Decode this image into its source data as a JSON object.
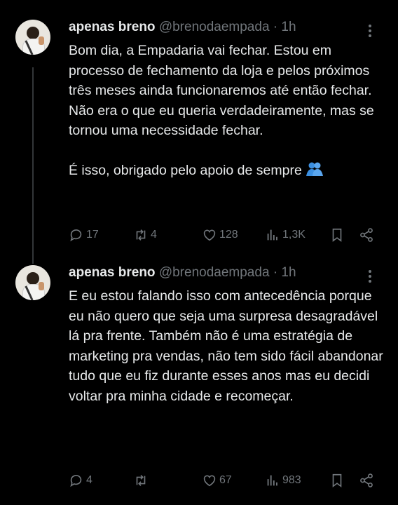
{
  "tweets": [
    {
      "name": "apenas breno",
      "handle": "@brenodaempada",
      "time": "1h",
      "text": "Bom dia, a Empadaria vai fechar. Estou em processo de fechamento da loja e pelos próximos três meses ainda funcionaremos até então fechar. Não era o que eu queria verdadeiramente, mas se tornou uma necessidade fechar.\n\nÉ isso, obrigado pelo apoio de sempre",
      "emoji": "people-hugging-emoji",
      "replies": "17",
      "reposts": "4",
      "likes": "128",
      "views": "1,3K"
    },
    {
      "name": "apenas breno",
      "handle": "@brenodaempada",
      "time": "1h",
      "text": "E eu estou falando isso com antecedência porque eu não quero que seja uma surpresa desagradável lá pra frente. Também não é uma estratégia de marketing pra vendas, não tem sido fácil abandonar tudo que eu fiz durante esses anos mas eu decidi voltar pra minha cidade e recomeçar.",
      "replies": "4",
      "reposts": "",
      "likes": "67",
      "views": "983"
    }
  ],
  "icons": [
    "reply-icon",
    "repost-icon",
    "like-icon",
    "views-icon",
    "bookmark-icon",
    "share-icon",
    "more-icon"
  ],
  "colors": {
    "background": "#000000",
    "text": "#e7e9ea",
    "muted": "#71767b",
    "thread_line": "#333639"
  }
}
